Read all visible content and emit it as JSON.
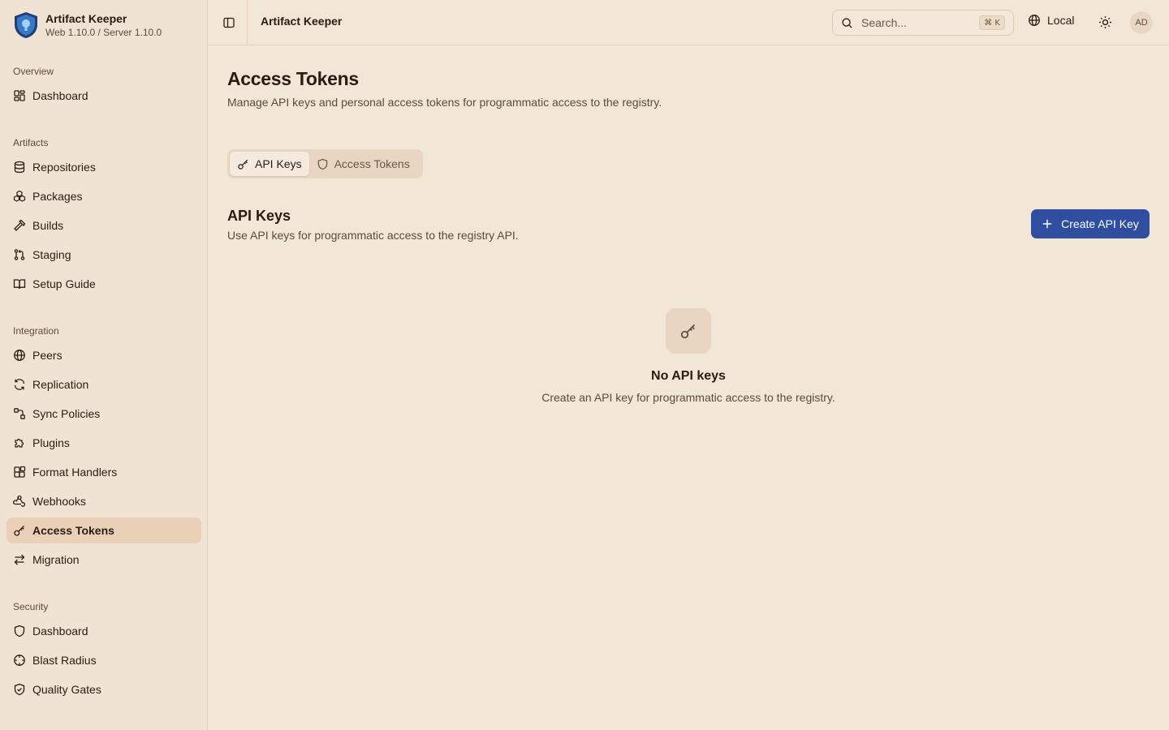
{
  "brand": {
    "name": "Artifact Keeper",
    "version": "Web 1.10.0 / Server 1.10.0"
  },
  "sidebar": {
    "sections": [
      {
        "heading": "Overview",
        "items": [
          {
            "label": "Dashboard",
            "icon": "dashboard-icon"
          }
        ]
      },
      {
        "heading": "Artifacts",
        "items": [
          {
            "label": "Repositories",
            "icon": "database-icon"
          },
          {
            "label": "Packages",
            "icon": "packages-icon"
          },
          {
            "label": "Builds",
            "icon": "hammer-icon"
          },
          {
            "label": "Staging",
            "icon": "git-pull-request-icon"
          },
          {
            "label": "Setup Guide",
            "icon": "book-icon"
          }
        ]
      },
      {
        "heading": "Integration",
        "items": [
          {
            "label": "Peers",
            "icon": "globe-icon"
          },
          {
            "label": "Replication",
            "icon": "refresh-icon"
          },
          {
            "label": "Sync Policies",
            "icon": "route-icon"
          },
          {
            "label": "Plugins",
            "icon": "puzzle-icon"
          },
          {
            "label": "Format Handlers",
            "icon": "blocks-icon"
          },
          {
            "label": "Webhooks",
            "icon": "webhook-icon"
          },
          {
            "label": "Access Tokens",
            "icon": "key-icon",
            "active": true
          },
          {
            "label": "Migration",
            "icon": "arrows-swap-icon"
          }
        ]
      },
      {
        "heading": "Security",
        "items": [
          {
            "label": "Dashboard",
            "icon": "shield-icon"
          },
          {
            "label": "Blast Radius",
            "icon": "crosshair-icon"
          },
          {
            "label": "Quality Gates",
            "icon": "shield-check-icon"
          }
        ]
      }
    ]
  },
  "topbar": {
    "title": "Artifact Keeper",
    "search_placeholder": "Search...",
    "search_shortcut": "⌘ K",
    "locale": "Local",
    "avatar": "AD"
  },
  "main": {
    "title": "Access Tokens",
    "description": "Manage API keys and personal access tokens for programmatic access to the registry.",
    "tabs": [
      {
        "label": "API Keys",
        "active": true
      },
      {
        "label": "Access Tokens",
        "active": false
      }
    ],
    "section_title": "API Keys",
    "section_description": "Use API keys for programmatic access to the registry API.",
    "create_button": "Create API Key",
    "empty_title": "No API keys",
    "empty_description": "Create an API key for programmatic access to the registry."
  },
  "colors": {
    "accent": "#2f4ea0",
    "background": "#f2e6d7",
    "sidebar": "#f0e3d3",
    "active_item": "#ebd0b8"
  }
}
